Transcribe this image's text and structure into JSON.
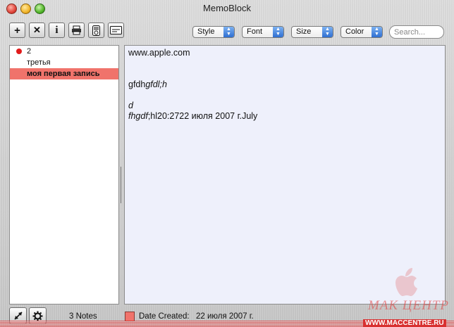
{
  "window": {
    "title": "MemoBlock"
  },
  "toolbar": {
    "buttons": [
      {
        "icon": "plus-icon",
        "glyph": "+"
      },
      {
        "icon": "delete-icon",
        "glyph": "✕"
      },
      {
        "icon": "info-icon",
        "glyph": "i"
      },
      {
        "icon": "print-icon"
      },
      {
        "icon": "ipod-icon"
      },
      {
        "icon": "card-icon"
      }
    ],
    "style_label": "Style",
    "font_label": "Font",
    "size_label": "Size",
    "color_label": "Color",
    "search_placeholder": "Search..."
  },
  "notes": [
    {
      "title": "2",
      "has_dot": true,
      "dot_color": "#e11b1b"
    },
    {
      "title": "третья"
    },
    {
      "title": "моя первая запись",
      "selected": true,
      "highlight_color": "#f0736b"
    }
  ],
  "editor": {
    "background_color": "#eef0fb",
    "lines": {
      "l1": "www.apple.com",
      "l4a": "gfdh",
      "l4b": "gfdl;h",
      "l6": "d",
      "l7a": "fhgdf",
      "l7b": ";hl20:2722 июля 2007 г.July"
    }
  },
  "footer": {
    "notes_count": "3 Notes",
    "date_created_label": "Date Created:",
    "date_created_value": "22 июля 2007 г.",
    "swatch_color": "#f0736b"
  },
  "watermark": {
    "name": "МАК ЦЕНТР",
    "url": "WWW.MACCENTRE.RU"
  }
}
